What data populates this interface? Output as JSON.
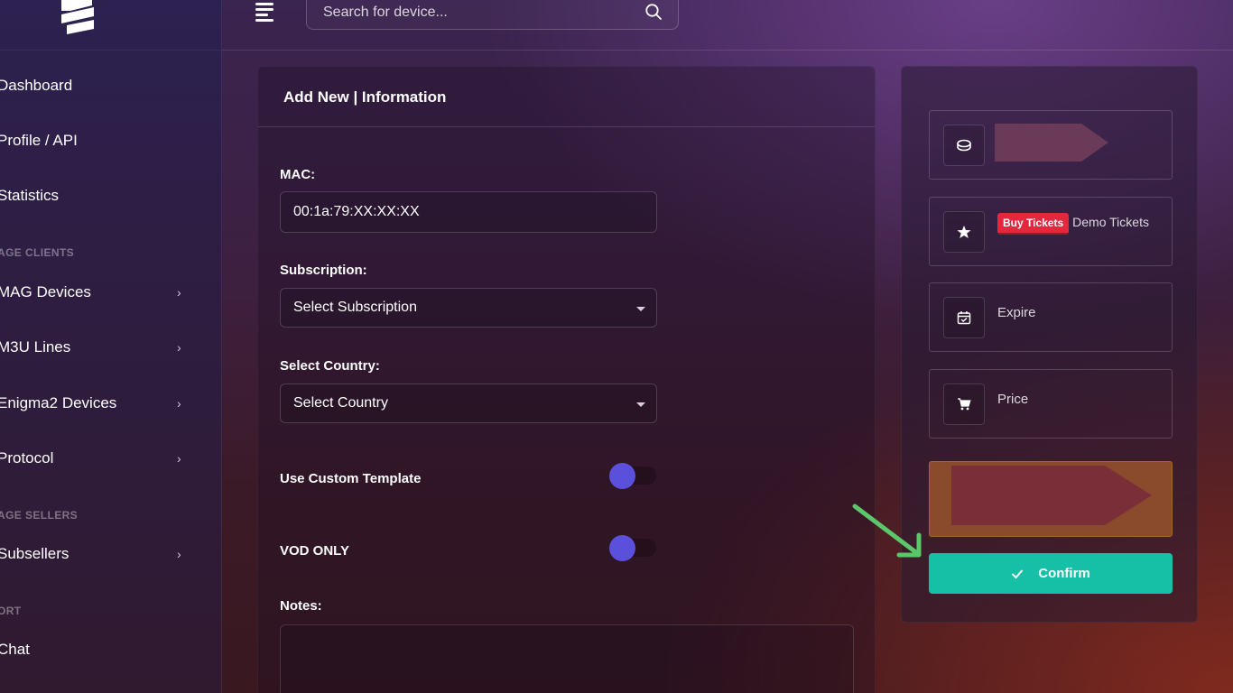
{
  "header": {
    "search_placeholder": "Search for device..."
  },
  "sidebar": {
    "items": [
      {
        "label": "Dashboard"
      },
      {
        "label": "Profile / API"
      },
      {
        "label": "Statistics"
      },
      {
        "section": "AGE CLIENTS"
      },
      {
        "label": "MAG Devices",
        "chevron": "›"
      },
      {
        "label": "M3U Lines",
        "chevron": "›"
      },
      {
        "label": "Enigma2 Devices",
        "chevron": "›"
      },
      {
        "label": "Protocol",
        "chevron": "›"
      },
      {
        "section": "AGE SELLERS"
      },
      {
        "label": "Subsellers",
        "chevron": "›"
      },
      {
        "section": "ORT"
      },
      {
        "label": "Chat"
      }
    ]
  },
  "form": {
    "title": "Add New | Information",
    "mac_label": "MAC:",
    "mac_value": "00:1a:79:XX:XX:XX",
    "subscription_label": "Subscription:",
    "subscription_value": "Select Subscription",
    "country_label": "Select Country:",
    "country_value": "Select Country",
    "custom_template_label": "Use Custom Template",
    "vod_only_label": "VOD ONLY",
    "notes_label": "Notes:"
  },
  "summary": {
    "buy_tickets_label": "Buy Tickets",
    "demo_tickets_label": "Demo Tickets",
    "expire_label": "Expire",
    "price_label": "Price",
    "confirm_label": "Confirm"
  },
  "colors": {
    "accent_toggle": "#5b50dc",
    "confirm": "#16c0a6",
    "badge": "#e3283d",
    "annotation_arrow": "#5cc66a",
    "highlight_box": "#8a4a2c"
  },
  "icons": {
    "logo": "brand-logo-icon",
    "menu": "hamburger-icon",
    "search": "search-icon",
    "coin": "coin-icon",
    "star": "star-icon",
    "calendar": "calendar-check-icon",
    "cart": "cart-icon",
    "check": "check-icon"
  }
}
